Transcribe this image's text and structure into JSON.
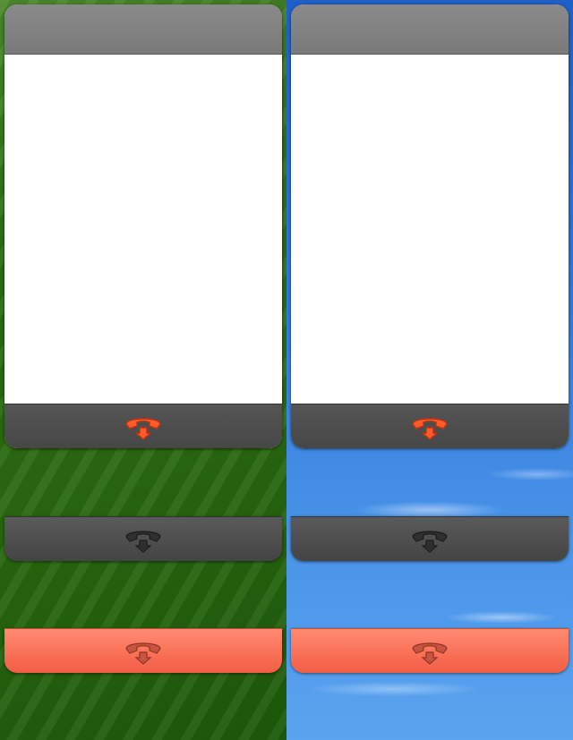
{
  "colors": {
    "panel_header": "#7f7f7f",
    "footer_dark": "#4a4a4a",
    "footer_red": "#f7705a",
    "icon_active": "#ff5a2a",
    "icon_inactive": "#2f2f2f",
    "icon_on_red": "#c8553f"
  },
  "icons": {
    "hangup": "phone-hangup-icon"
  },
  "backgrounds": {
    "left": "green-grass",
    "right": "blue-sky"
  }
}
